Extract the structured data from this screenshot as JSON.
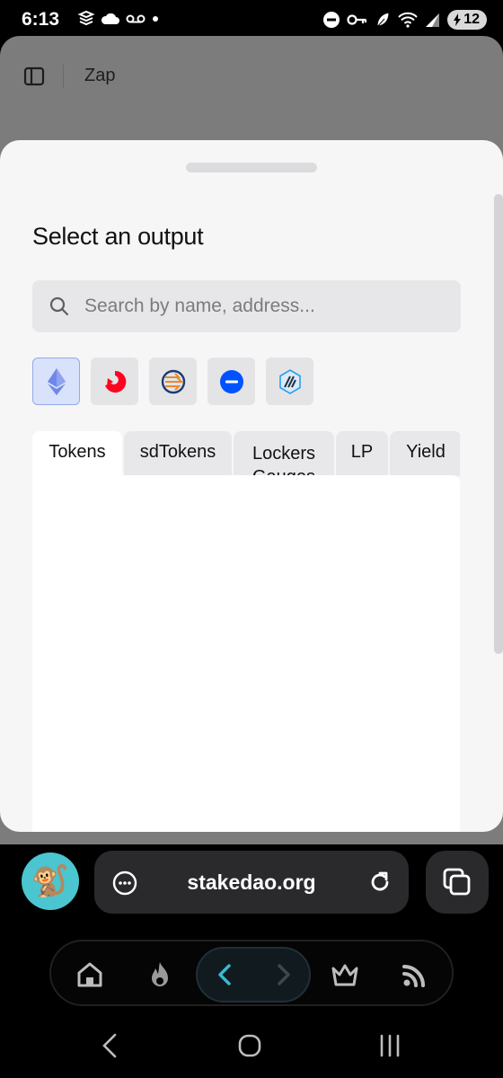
{
  "status_bar": {
    "time": "6:13",
    "battery": "12",
    "left_icons": [
      "stack-icon",
      "cloud-icon",
      "voicemail-icon",
      "dot-icon"
    ],
    "right_icons": [
      "dnd-icon",
      "key-icon",
      "leaf-icon",
      "wifi-icon",
      "signal-icon",
      "battery-icon"
    ]
  },
  "page_header": {
    "title": "Zap"
  },
  "sheet": {
    "title": "Select an output",
    "search": {
      "placeholder": "Search by name, address...",
      "value": ""
    },
    "chains": [
      {
        "name": "ethereum",
        "selected": true
      },
      {
        "name": "optimism",
        "selected": false
      },
      {
        "name": "fraxtal",
        "selected": false
      },
      {
        "name": "base",
        "selected": false
      },
      {
        "name": "arbitrum",
        "selected": false
      }
    ],
    "tabs": [
      {
        "label": "Tokens",
        "active": true
      },
      {
        "label": "sdTokens",
        "active": false
      },
      {
        "label": "Lockers Gauges",
        "active": false
      },
      {
        "label": "LP",
        "active": false
      },
      {
        "label": "Yield",
        "active": false
      }
    ]
  },
  "browser": {
    "url": "stakedao.org",
    "avatar_icon": "monkey-icon"
  },
  "bottom_nav": {
    "items": [
      "home-icon",
      "fire-icon",
      "back-arrow-icon",
      "forward-arrow-icon",
      "crown-icon",
      "feed-icon"
    ]
  },
  "colors": {
    "accent_blue": "#0052ff",
    "selected_chain_bg": "#d9e2fb",
    "back_arrow": "#3bb8d3"
  }
}
